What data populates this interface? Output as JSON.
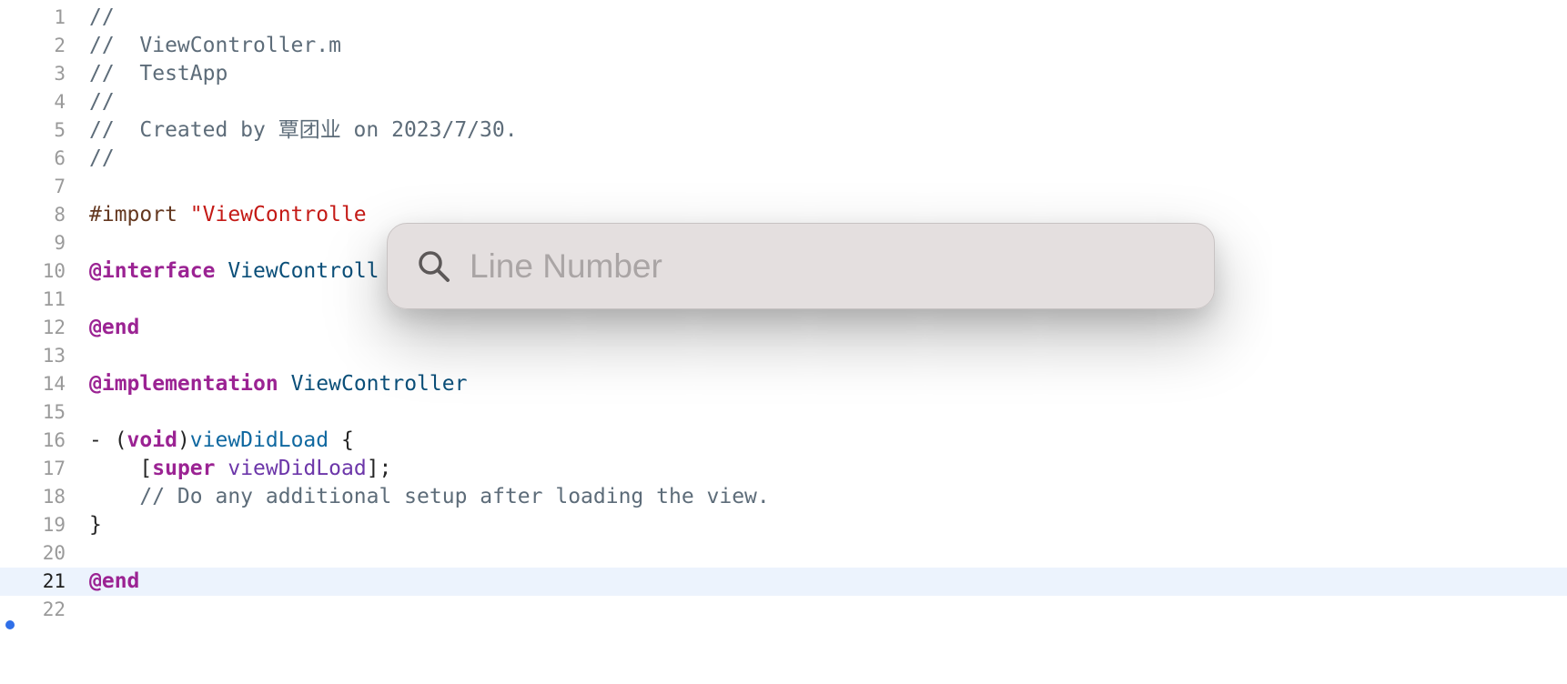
{
  "editor": {
    "lines": [
      {
        "n": "1",
        "tokens": [
          {
            "t": "//",
            "c": "comment"
          }
        ]
      },
      {
        "n": "2",
        "tokens": [
          {
            "t": "//  ViewController.m",
            "c": "comment"
          }
        ]
      },
      {
        "n": "3",
        "tokens": [
          {
            "t": "//  TestApp",
            "c": "comment"
          }
        ]
      },
      {
        "n": "4",
        "tokens": [
          {
            "t": "//",
            "c": "comment"
          }
        ]
      },
      {
        "n": "5",
        "tokens": [
          {
            "t": "//  Created by 覃团业 on 2023/7/30.",
            "c": "comment"
          }
        ]
      },
      {
        "n": "6",
        "tokens": [
          {
            "t": "//",
            "c": "comment"
          }
        ]
      },
      {
        "n": "7",
        "tokens": []
      },
      {
        "n": "8",
        "tokens": [
          {
            "t": "#import ",
            "c": "preproc"
          },
          {
            "t": "\"ViewControlle",
            "c": "string"
          }
        ]
      },
      {
        "n": "9",
        "tokens": []
      },
      {
        "n": "10",
        "tokens": [
          {
            "t": "@interface",
            "c": "keyword"
          },
          {
            "t": " ",
            "c": "plain"
          },
          {
            "t": "ViewControll",
            "c": "type"
          }
        ]
      },
      {
        "n": "11",
        "tokens": []
      },
      {
        "n": "12",
        "tokens": [
          {
            "t": "@end",
            "c": "keyword"
          }
        ]
      },
      {
        "n": "13",
        "tokens": []
      },
      {
        "n": "14",
        "tokens": [
          {
            "t": "@implementation",
            "c": "keyword"
          },
          {
            "t": " ",
            "c": "plain"
          },
          {
            "t": "ViewController",
            "c": "type"
          }
        ]
      },
      {
        "n": "15",
        "tokens": []
      },
      {
        "n": "16",
        "tokens": [
          {
            "t": "- (",
            "c": "plain"
          },
          {
            "t": "void",
            "c": "keyword"
          },
          {
            "t": ")",
            "c": "plain"
          },
          {
            "t": "viewDidLoad",
            "c": "decl"
          },
          {
            "t": " {",
            "c": "plain"
          }
        ]
      },
      {
        "n": "17",
        "tokens": [
          {
            "t": "    [",
            "c": "plain"
          },
          {
            "t": "super",
            "c": "super"
          },
          {
            "t": " ",
            "c": "plain"
          },
          {
            "t": "viewDidLoad",
            "c": "methodcall"
          },
          {
            "t": "];",
            "c": "plain"
          }
        ]
      },
      {
        "n": "18",
        "tokens": [
          {
            "t": "    // Do any additional setup after loading the view.",
            "c": "comment"
          }
        ]
      },
      {
        "n": "19",
        "tokens": [
          {
            "t": "}",
            "c": "plain"
          }
        ]
      },
      {
        "n": "20",
        "tokens": []
      },
      {
        "n": "21",
        "tokens": [
          {
            "t": "@end",
            "c": "keyword"
          }
        ],
        "current": true
      },
      {
        "n": "22",
        "tokens": []
      }
    ]
  },
  "goto_line": {
    "placeholder": "Line Number",
    "value": "",
    "icon": "search-icon"
  },
  "colors": {
    "comment": "#5d6c79",
    "keyword": "#9b2393",
    "string": "#c41a16",
    "type": "#0b4f79",
    "current_line": "#ecf3fd",
    "popup_bg": "#e4dfdf"
  }
}
